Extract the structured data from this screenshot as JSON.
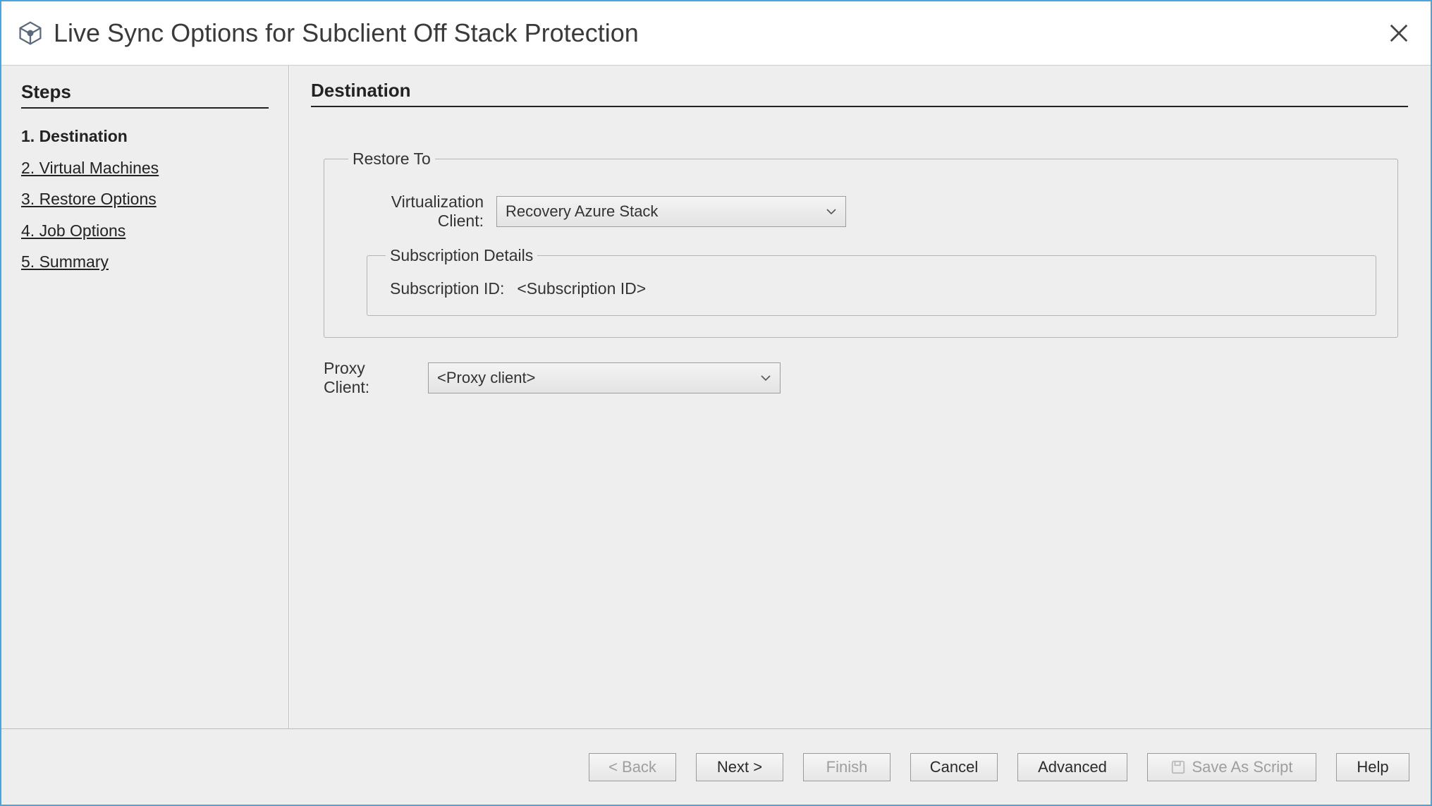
{
  "window": {
    "title": "Live Sync Options for Subclient Off Stack Protection"
  },
  "sidebar": {
    "heading": "Steps",
    "steps": [
      {
        "label": "1. Destination",
        "current": true
      },
      {
        "label": "2. Virtual Machines",
        "current": false
      },
      {
        "label": "3. Restore Options",
        "current": false
      },
      {
        "label": "4. Job Options",
        "current": false
      },
      {
        "label": "5. Summary",
        "current": false
      }
    ]
  },
  "main": {
    "heading": "Destination",
    "restore_to_legend": "Restore To",
    "virt_client_label": "Virtualization Client:",
    "virt_client_value": "Recovery Azure Stack",
    "sub_details_legend": "Subscription Details",
    "sub_id_label": "Subscription ID:",
    "sub_id_value": "<Subscription ID>",
    "proxy_label": "Proxy Client:",
    "proxy_value": "<Proxy client>"
  },
  "footer": {
    "back": "< Back",
    "next": "Next >",
    "finish": "Finish",
    "cancel": "Cancel",
    "advanced": "Advanced",
    "save_as_script": "Save As Script",
    "help": "Help"
  }
}
